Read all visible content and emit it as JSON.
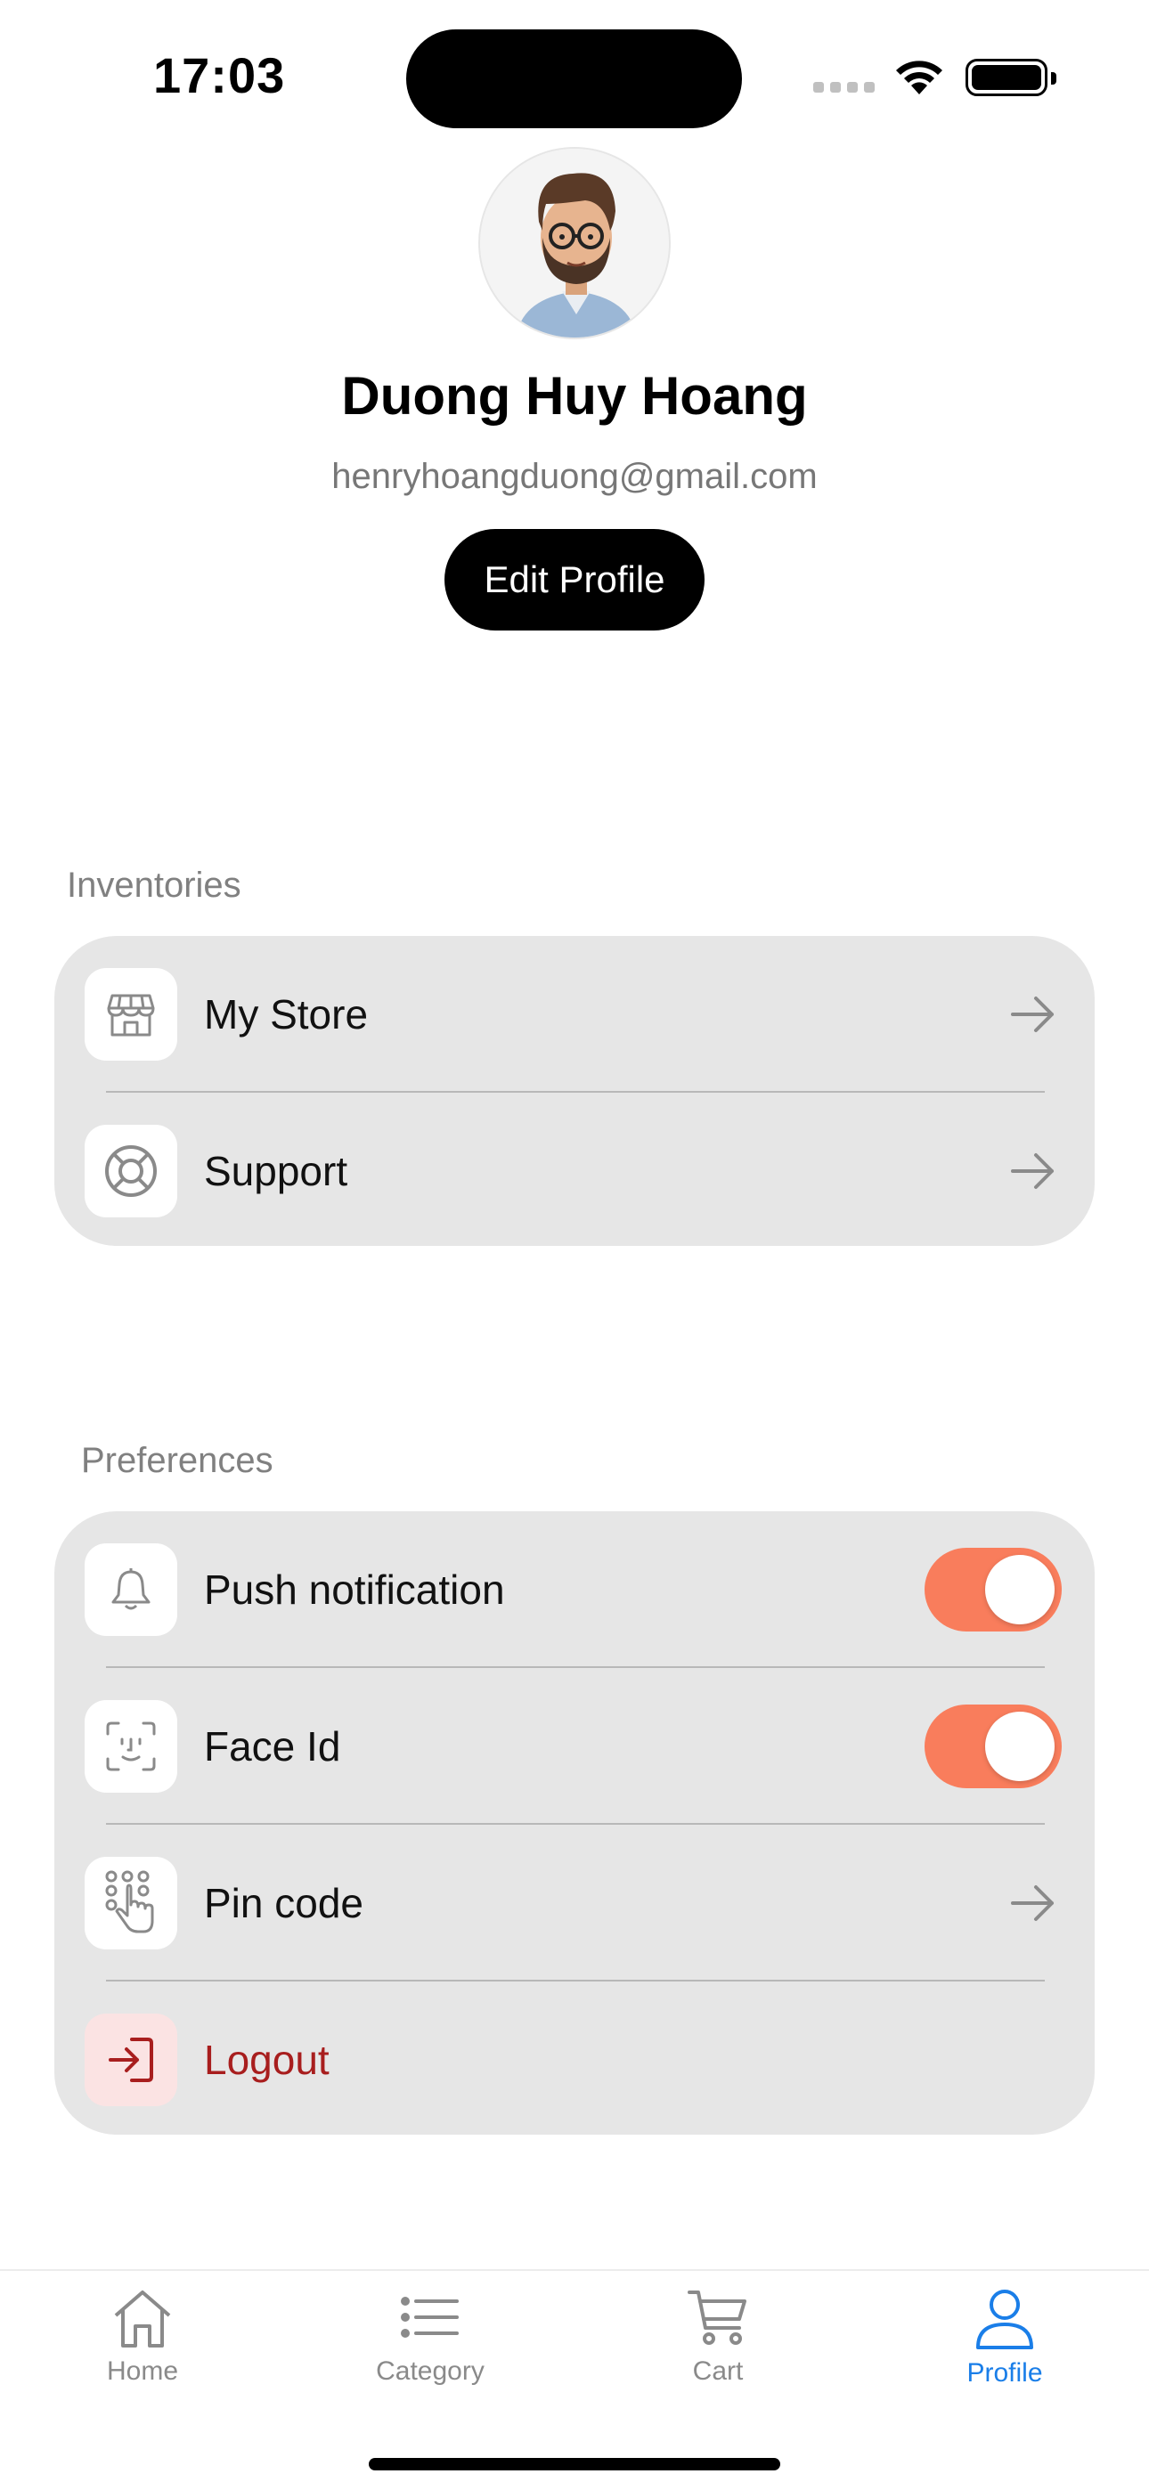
{
  "status_bar": {
    "time": "17:03"
  },
  "profile": {
    "name": "Duong Huy Hoang",
    "email": "henryhoangduong@gmail.com",
    "edit_label": "Edit Profile"
  },
  "inventories": {
    "title": "Inventories",
    "items": [
      {
        "label": "My Store",
        "icon": "store-icon"
      },
      {
        "label": "Support",
        "icon": "lifebuoy-icon"
      }
    ]
  },
  "preferences": {
    "title": "Preferences",
    "items": [
      {
        "label": "Push notification",
        "icon": "bell-icon",
        "toggle": true
      },
      {
        "label": "Face Id",
        "icon": "face-id-icon",
        "toggle": true
      },
      {
        "label": "Pin code",
        "icon": "keypad-hand-icon"
      },
      {
        "label": "Logout",
        "icon": "logout-icon"
      }
    ]
  },
  "tabs": [
    {
      "label": "Home",
      "icon": "home-icon"
    },
    {
      "label": "Category",
      "icon": "list-icon"
    },
    {
      "label": "Cart",
      "icon": "cart-icon"
    },
    {
      "label": "Profile",
      "icon": "person-icon",
      "active": true
    }
  ],
  "colors": {
    "toggle_on": "#f97d5c",
    "active_tab": "#1a7ee8",
    "danger": "#a81e1e"
  }
}
